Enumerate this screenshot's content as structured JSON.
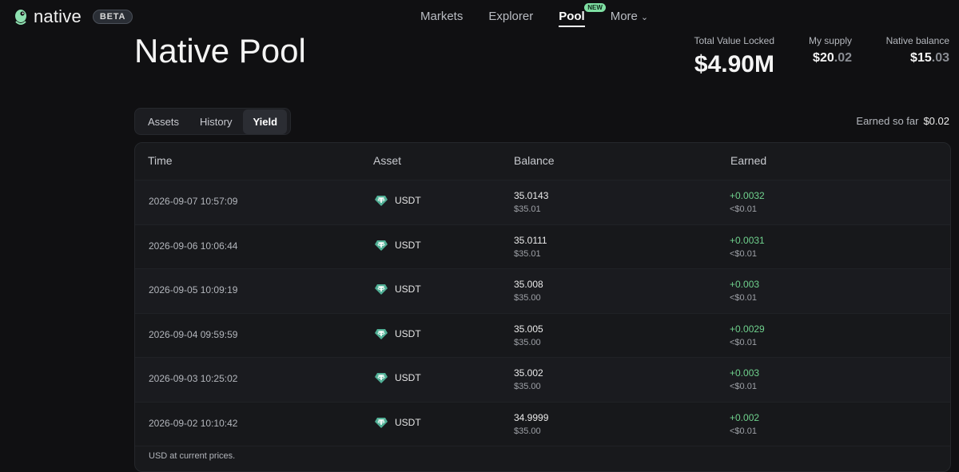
{
  "brand": {
    "name": "native",
    "badge": "BETA"
  },
  "nav": {
    "items": [
      {
        "label": "Markets"
      },
      {
        "label": "Explorer"
      },
      {
        "label": "Pool",
        "badge": "NEW",
        "active": true
      },
      {
        "label": "More"
      }
    ]
  },
  "page": {
    "title": "Native Pool"
  },
  "stats": {
    "tvl": {
      "label": "Total Value Locked",
      "value": "$4.90M"
    },
    "supply": {
      "label": "My supply",
      "value_main": "$20",
      "value_dec": ".02"
    },
    "native_balance": {
      "label": "Native balance",
      "value_main": "$15",
      "value_dec": ".03"
    }
  },
  "tabs": [
    {
      "label": "Assets"
    },
    {
      "label": "History"
    },
    {
      "label": "Yield",
      "active": true
    }
  ],
  "earned_so_far": {
    "label": "Earned so far",
    "value": "$0.02"
  },
  "table": {
    "headers": {
      "time": "Time",
      "asset": "Asset",
      "balance": "Balance",
      "earned": "Earned"
    },
    "rows": [
      {
        "time": "2026-09-07 10:57:09",
        "asset": "USDT",
        "balance": "35.0143",
        "balance_usd": "$35.01",
        "earned": "+0.0032",
        "earned_usd": "<$0.01"
      },
      {
        "time": "2026-09-06 10:06:44",
        "asset": "USDT",
        "balance": "35.0111",
        "balance_usd": "$35.01",
        "earned": "+0.0031",
        "earned_usd": "<$0.01"
      },
      {
        "time": "2026-09-05 10:09:19",
        "asset": "USDT",
        "balance": "35.008",
        "balance_usd": "$35.00",
        "earned": "+0.003",
        "earned_usd": "<$0.01"
      },
      {
        "time": "2026-09-04 09:59:59",
        "asset": "USDT",
        "balance": "35.005",
        "balance_usd": "$35.00",
        "earned": "+0.0029",
        "earned_usd": "<$0.01"
      },
      {
        "time": "2026-09-03 10:25:02",
        "asset": "USDT",
        "balance": "35.002",
        "balance_usd": "$35.00",
        "earned": "+0.003",
        "earned_usd": "<$0.01"
      },
      {
        "time": "2026-09-02 10:10:42",
        "asset": "USDT",
        "balance": "34.9999",
        "balance_usd": "$35.00",
        "earned": "+0.002",
        "earned_usd": "<$0.01"
      }
    ],
    "footnote": "USD at current prices."
  },
  "colors": {
    "background": "#101012",
    "positive": "#6fd18d",
    "new_badge": "#7fe0a3",
    "usdt_icon": "#50af95"
  },
  "icons": {
    "logo": "native-logo-icon",
    "asset": "usdt-icon",
    "more": "chevron-down-icon"
  }
}
